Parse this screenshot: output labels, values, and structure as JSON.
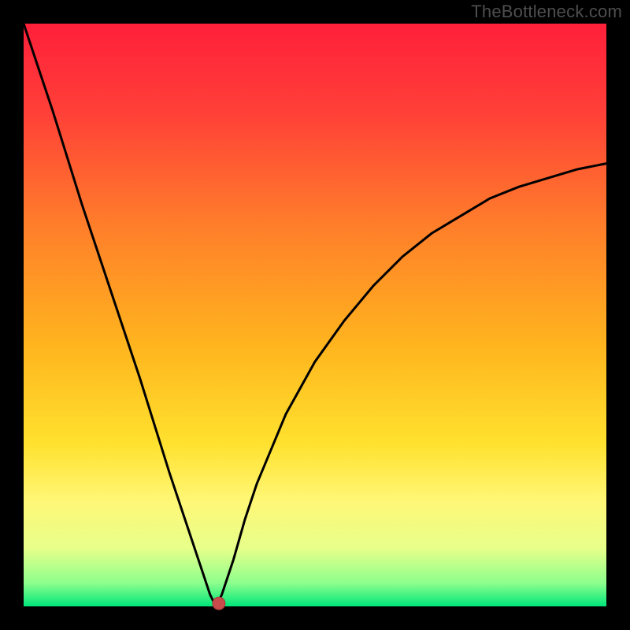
{
  "watermark": "TheBottleneck.com",
  "colors": {
    "frame": "#000000",
    "curve": "#000000",
    "marker_fill": "#c94b4b",
    "marker_stroke": "#a83838",
    "gradient_stops": [
      {
        "pct": 0,
        "color": "#ff1f3a"
      },
      {
        "pct": 15,
        "color": "#ff3f38"
      },
      {
        "pct": 35,
        "color": "#ff7f2a"
      },
      {
        "pct": 55,
        "color": "#ffb41e"
      },
      {
        "pct": 72,
        "color": "#ffe12e"
      },
      {
        "pct": 82,
        "color": "#fff777"
      },
      {
        "pct": 90,
        "color": "#e7ff8a"
      },
      {
        "pct": 96,
        "color": "#8dff8d"
      },
      {
        "pct": 100,
        "color": "#00e67a"
      }
    ]
  },
  "chart_data": {
    "type": "line",
    "title": "",
    "xlabel": "",
    "ylabel": "",
    "xlim": [
      0,
      100
    ],
    "ylim": [
      0,
      100
    ],
    "grid": false,
    "legend": false,
    "description": "V-shaped bottleneck curve. Steep linear drop from top-left to a sharp minimum near x≈33, then a concave rise toward an upper asymptote near y≈76 at the right edge. A marker dot sits at the minimum.",
    "x": [
      0,
      5,
      10,
      15,
      20,
      25,
      28,
      30,
      32,
      33,
      34,
      36,
      38,
      40,
      45,
      50,
      55,
      60,
      65,
      70,
      75,
      80,
      85,
      90,
      95,
      100
    ],
    "values": [
      100,
      85,
      69,
      54,
      39,
      23,
      14,
      8,
      2,
      0,
      2,
      8,
      15,
      21,
      33,
      42,
      49,
      55,
      60,
      64,
      67,
      70,
      72,
      73.5,
      75,
      76
    ],
    "marker": {
      "x": 33.5,
      "y": 0.5
    }
  }
}
